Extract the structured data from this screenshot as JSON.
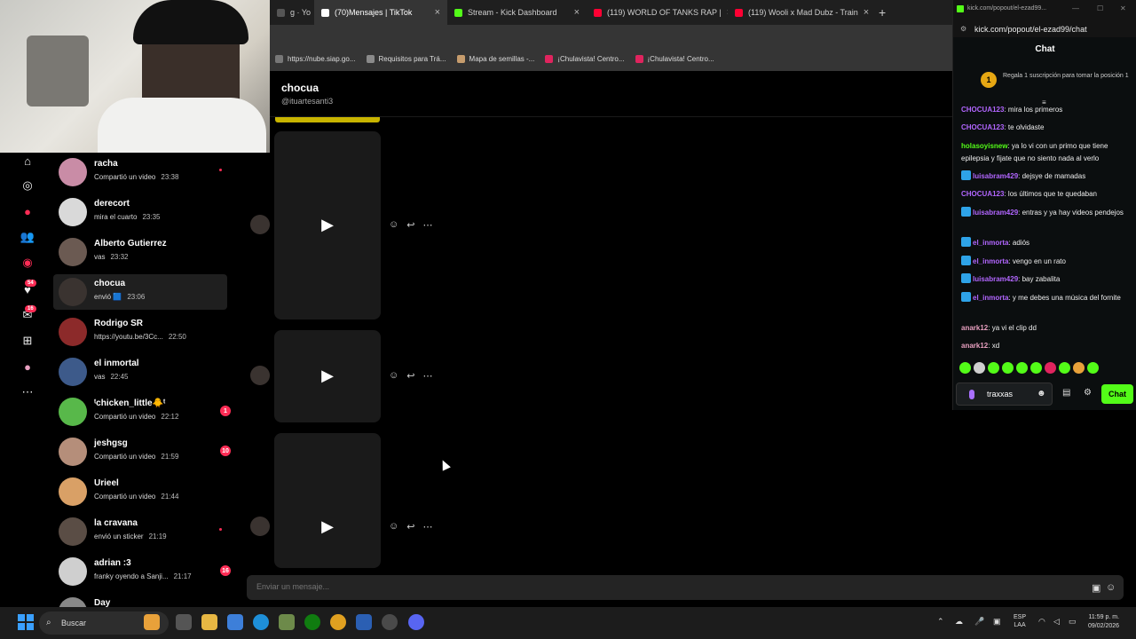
{
  "browser": {
    "tabs": [
      {
        "label": "g · Yo",
        "active": false,
        "favicon_color": "#555555"
      },
      {
        "label": "(70)Mensajes | TikTok",
        "active": true,
        "favicon_color": "#ffffff"
      },
      {
        "label": "Stream - Kick Dashboard",
        "active": false,
        "favicon_color": "#53fc18"
      },
      {
        "label": "(119) WORLD OF TANKS RAP |",
        "active": false,
        "favicon_color": "#ff0033"
      },
      {
        "label": "(119) Wooli x Mad Dubz - Train",
        "active": false,
        "favicon_color": "#ff0033"
      }
    ],
    "new_tab": "+",
    "bookmarks": [
      {
        "label": "https://nube.siap.go...",
        "color": "#777777"
      },
      {
        "label": "Requisitos para Trá...",
        "color": "#8a8a8a"
      },
      {
        "label": "Mapa de semillas -...",
        "color": "#c69c6d"
      },
      {
        "label": "¡Chulavista! Centro...",
        "color": "#e0245e"
      },
      {
        "label": "¡Chulavista! Centro...",
        "color": "#e0245e"
      }
    ]
  },
  "rail": {
    "badges": [
      "54",
      "16"
    ]
  },
  "conversations": [
    {
      "name": "racha",
      "preview": "Compartió un video",
      "time": "23:38",
      "badge": "",
      "dot": true,
      "avatar_color": "#c98ca6",
      "active": false
    },
    {
      "name": "derecort",
      "preview": "mira el cuarto",
      "time": "23:35",
      "badge": "",
      "dot": false,
      "avatar_color": "#d9d9d9",
      "active": false
    },
    {
      "name": "Alberto Gutierrez",
      "preview": "vas",
      "time": "23:32",
      "badge": "",
      "dot": false,
      "avatar_color": "#6b5a52",
      "active": false
    },
    {
      "name": "chocua",
      "preview": "envió 🟦",
      "time": "23:06",
      "badge": "",
      "dot": false,
      "avatar_color": "#3a3330",
      "active": true
    },
    {
      "name": "Rodrigo SR",
      "preview": "https://youtu.be/3Cc...",
      "time": "22:50",
      "badge": "",
      "dot": false,
      "avatar_color": "#8c2a2a",
      "active": false
    },
    {
      "name": "el inmortal",
      "preview": "vas",
      "time": "22:45",
      "badge": "",
      "dot": false,
      "avatar_color": "#3d5a8a",
      "active": false
    },
    {
      "name": "ᵗchicken_little🐥ᵗ",
      "preview": "Compartió un video",
      "time": "22:12",
      "badge": "1",
      "dot": false,
      "avatar_color": "#58b84a",
      "active": false
    },
    {
      "name": "jeshgsg",
      "preview": "Compartió un video",
      "time": "21:59",
      "badge": "10",
      "dot": false,
      "avatar_color": "#b58e7a",
      "active": false
    },
    {
      "name": "Urieel",
      "preview": "Compartió un video",
      "time": "21:44",
      "badge": "",
      "dot": false,
      "avatar_color": "#d9a066",
      "active": false
    },
    {
      "name": "la cravana",
      "preview": "envió un sticker",
      "time": "21:19",
      "badge": "",
      "dot": true,
      "avatar_color": "#5a4d45",
      "active": false
    },
    {
      "name": "adrian :3",
      "preview": "franky oyendo a Sanji...",
      "time": "21:17",
      "badge": "16",
      "dot": false,
      "avatar_color": "#cfcfcf",
      "active": false
    },
    {
      "name": "Day",
      "preview": "",
      "time": "",
      "badge": "",
      "dot": false,
      "avatar_color": "#888888",
      "active": false
    }
  ],
  "chat": {
    "name": "chocua",
    "handle": "@ituartesanti3",
    "composer_placeholder": "Enviar un mensaje..."
  },
  "messages": [
    {
      "type": "video"
    },
    {
      "type": "video"
    },
    {
      "type": "video"
    }
  ],
  "kick": {
    "window_title": "kick.com/popout/el-ezad99...",
    "url": "kick.com/popout/el-ezad99/chat",
    "header": "Chat",
    "gift_rank": "1",
    "gift_text": "Regala 1 suscripción para tomar la posición 1",
    "messages": [
      {
        "user": "CHOCUA123",
        "color": "#b266ff",
        "text": "mira los primeros",
        "badge": false
      },
      {
        "user": "CHOCUA123",
        "color": "#b266ff",
        "text": "te olvidaste",
        "badge": false
      },
      {
        "user": "holasoyisnew",
        "color": "#53fc18",
        "text": "ya lo vi con un primo que tiene epilepsia y fijate que no siento nada al verlo",
        "badge": false
      },
      {
        "user": "luisabram429",
        "color": "#b266ff",
        "text": "dejsye de mamadas",
        "badge": true
      },
      {
        "user": "CHOCUA123",
        "color": "#b266ff",
        "text": "los últimos que te quedaban",
        "badge": false
      },
      {
        "user": "luisabram429",
        "color": "#b266ff",
        "text": "entras y ya hay videos pendejos",
        "badge": true
      },
      {
        "user": "el_inmorta",
        "color": "#b266ff",
        "text": "adiós",
        "badge": true
      },
      {
        "user": "el_inmorta",
        "color": "#b266ff",
        "text": "vengo en un rato",
        "badge": true
      },
      {
        "user": "luisabram429",
        "color": "#b266ff",
        "text": "bay zabalita",
        "badge": true
      },
      {
        "user": "el_inmorta",
        "color": "#b266ff",
        "text": "y me debes una música del fornite",
        "badge": true
      },
      {
        "user": "anark12",
        "color": "#e8a0c0",
        "text": "ya vi el clip dd",
        "badge": false
      },
      {
        "user": "anark12",
        "color": "#e8a0c0",
        "text": "xd",
        "badge": false
      }
    ],
    "input_value": "traxxas",
    "send_label": "Chat"
  },
  "taskbar": {
    "search_label": "Buscar",
    "lang_line1": "ESP",
    "lang_line2": "LAA",
    "time": "11:59 p. m.",
    "date": "09/02/2026"
  }
}
